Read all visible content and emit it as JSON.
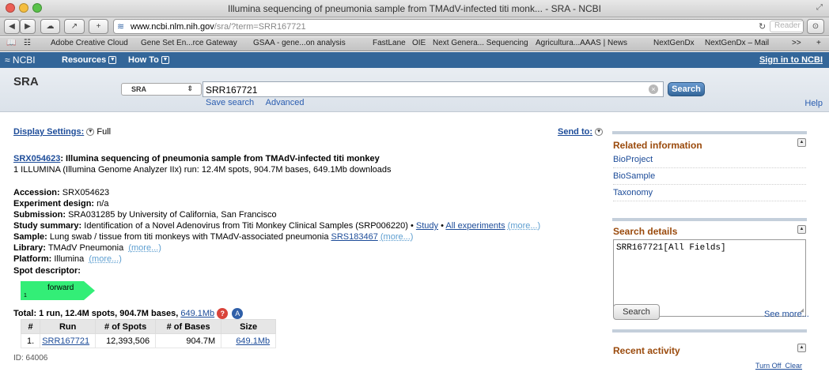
{
  "window": {
    "title": "Illumina sequencing of pneumonia sample from TMAdV-infected titi monk... - SRA - NCBI"
  },
  "browser": {
    "url_domain": "www.ncbi.nlm.nih.gov",
    "url_path": "/sra/?term=SRR167721",
    "reader_label": "Reader",
    "bookmarks": [
      "Adobe Creative Cloud",
      "Gene Set En...rce Gateway",
      "GSAA - gene...on analysis",
      "FastLane",
      "OIE",
      "Next Genera... Sequencing",
      "Agricultura...AAAS | News",
      "NextGenDx",
      "NextGenDx – Mail"
    ],
    "bookmarks_overflow": ">>",
    "add_tab": "+"
  },
  "ncbi": {
    "logo": "NCBI",
    "menu_resources": "Resources",
    "menu_howto": "How To",
    "sign_in": "Sign in to NCBI"
  },
  "search": {
    "db_title": "SRA",
    "db_select": "SRA",
    "term": "SRR167721",
    "button": "Search",
    "save_search": "Save search",
    "advanced": "Advanced",
    "help": "Help"
  },
  "record": {
    "display_settings_label": "Display Settings:",
    "display_settings_value": "Full",
    "send_to": "Send to:",
    "accession_link": "SRX054623",
    "title_rest": ": Illumina sequencing of pneumonia sample from TMAdV-infected titi monkey",
    "subtitle": "1 ILLUMINA (Illumina Genome Analyzer IIx) run: 12.4M spots, 904.7M bases, 649.1Mb downloads",
    "accession_label": "Accession:",
    "accession_value": "SRX054623",
    "design_label": "Experiment design:",
    "design_value": "n/a",
    "submission_label": "Submission:",
    "submission_value": "SRA031285 by University of California, San Francisco",
    "study_label": "Study summary:",
    "study_value": "Identification of a Novel Adenovirus from Titi Monkey Clinical Samples (SRP006220) •",
    "study_link": "Study",
    "study_sep": "•",
    "all_experiments": "All experiments",
    "more": "(more...)",
    "sample_label": "Sample:",
    "sample_value": "Lung swab / tissue from titi monkeys with TMAdV-associated pneumonia",
    "sample_link": "SRS183467",
    "library_label": "Library:",
    "library_value": "TMAdV Pneumonia",
    "platform_label": "Platform:",
    "platform_value": "Illumina",
    "spot_label": "Spot descriptor:",
    "spot_num": "1",
    "spot_text": "forward",
    "total_text": "Total: 1 run, 12.4M spots, 904.7M bases,",
    "total_link": "649.1Mb",
    "q_icon": "?",
    "x_icon": "A",
    "id_line": "ID: 64006"
  },
  "runs_table": {
    "headers": [
      "#",
      "Run",
      "# of Spots",
      "# of Bases",
      "Size"
    ],
    "rows": [
      [
        "1.",
        "SRR167721",
        "12,393,506",
        "904.7M",
        "649.1Mb"
      ]
    ]
  },
  "sidebar": {
    "related_title": "Related information",
    "related_links": [
      "BioProject",
      "BioSample",
      "Taxonomy"
    ],
    "details_title": "Search details",
    "details_text": "SRR167721[All Fields]",
    "search_button": "Search",
    "see_more": "See more...",
    "recent_title": "Recent activity",
    "turn_off": "Turn Off",
    "clear": "Clear"
  },
  "colors": {
    "ncbi_blue": "#336699",
    "sidebar_title": "#9a4a0c",
    "link": "#1d4c99",
    "spot_green": "#33ee77"
  }
}
